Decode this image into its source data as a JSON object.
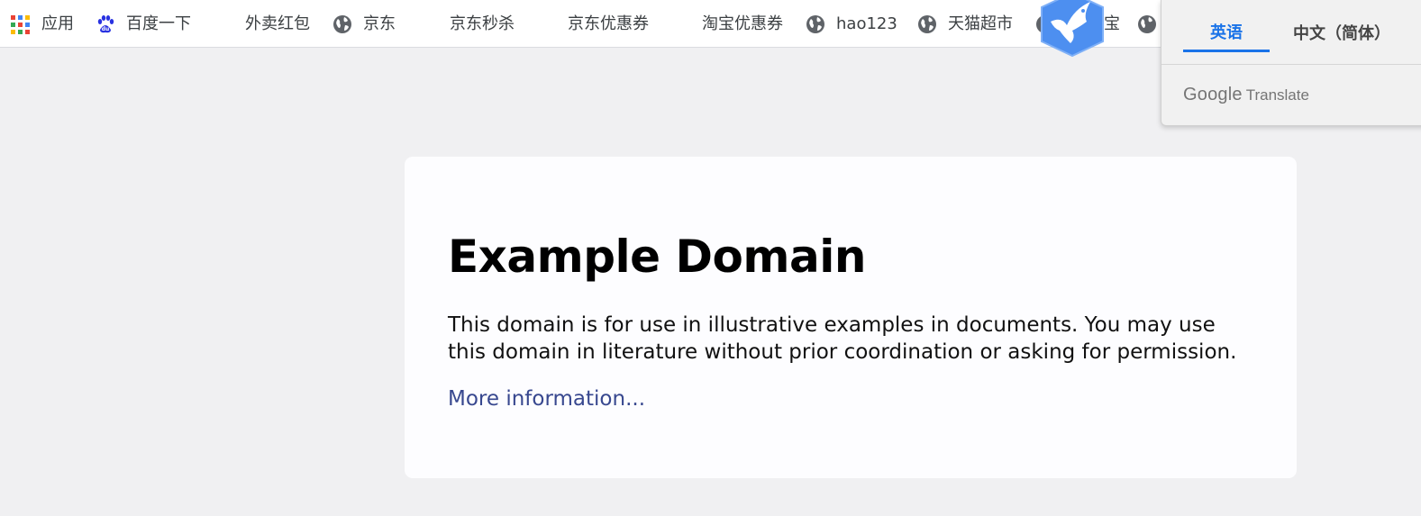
{
  "bookmarks": [
    {
      "label": "应用",
      "icon": "apps-grid-icon"
    },
    {
      "label": "百度一下",
      "icon": "baidu-paw-icon"
    },
    {
      "label": "外卖红包",
      "icon": ""
    },
    {
      "label": "京东",
      "icon": "globe-icon"
    },
    {
      "label": "京东秒杀",
      "icon": ""
    },
    {
      "label": "京东优惠券",
      "icon": ""
    },
    {
      "label": "淘宝优惠券",
      "icon": ""
    },
    {
      "label": "hao123",
      "icon": "globe-icon"
    },
    {
      "label": "天猫超市",
      "icon": "globe-icon"
    },
    {
      "label": "宝",
      "icon": "globe-icon"
    },
    {
      "label": "",
      "icon": "globe-icon"
    }
  ],
  "translate_popup": {
    "tabs": [
      {
        "label": "英语",
        "active": true
      },
      {
        "label": "中文（简体）",
        "active": false
      }
    ],
    "brand_google": "Google",
    "brand_translate": "Translate"
  },
  "page": {
    "title": "Example Domain",
    "body": "This domain is for use in illustrative examples in documents. You may use this domain in literature without prior coordination or asking for permission.",
    "link_text": "More information..."
  },
  "colors": {
    "page_background": "#f0f0f2",
    "card_background": "#fdfdff",
    "link": "#38488f",
    "translate_active": "#1a73e8",
    "extension_badge": "#5b9cf3"
  }
}
